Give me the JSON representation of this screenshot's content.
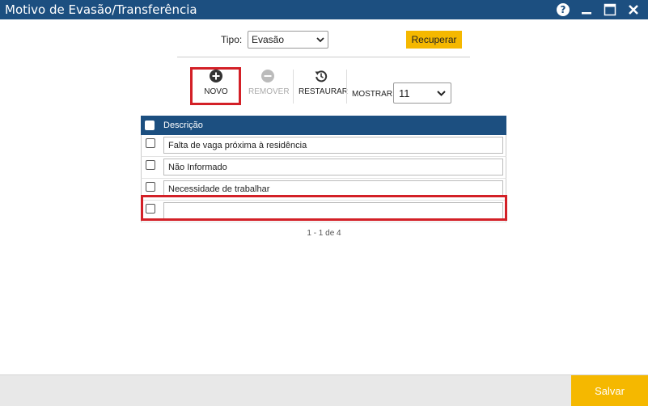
{
  "window": {
    "title": "Motivo de Evasão/Transferência",
    "help_symbol": "?",
    "minimize_symbol": "—",
    "maximize_symbol": "▭",
    "close_symbol": "✕"
  },
  "filter": {
    "tipo_label": "Tipo:",
    "tipo_value": "Evasão",
    "recuperar_label": "Recuperar"
  },
  "toolbar": {
    "novo_label": "NOVO",
    "remover_label": "REMOVER",
    "restaurar_label": "RESTAURAR",
    "mostrar_label": "MOSTRAR:",
    "mostrar_value": "11"
  },
  "grid": {
    "header": "Descrição",
    "rows": [
      {
        "descricao": "Falta de vaga próxima à residência"
      },
      {
        "descricao": "Não Informado"
      },
      {
        "descricao": "Necessidade de trabalhar"
      },
      {
        "descricao": ""
      }
    ]
  },
  "pager": {
    "text": "1 - 1 de 4"
  },
  "footer": {
    "salvar_label": "Salvar"
  },
  "colors": {
    "titlebar": "#1c4f80",
    "accent": "#f5b800",
    "highlight": "#d32027"
  }
}
